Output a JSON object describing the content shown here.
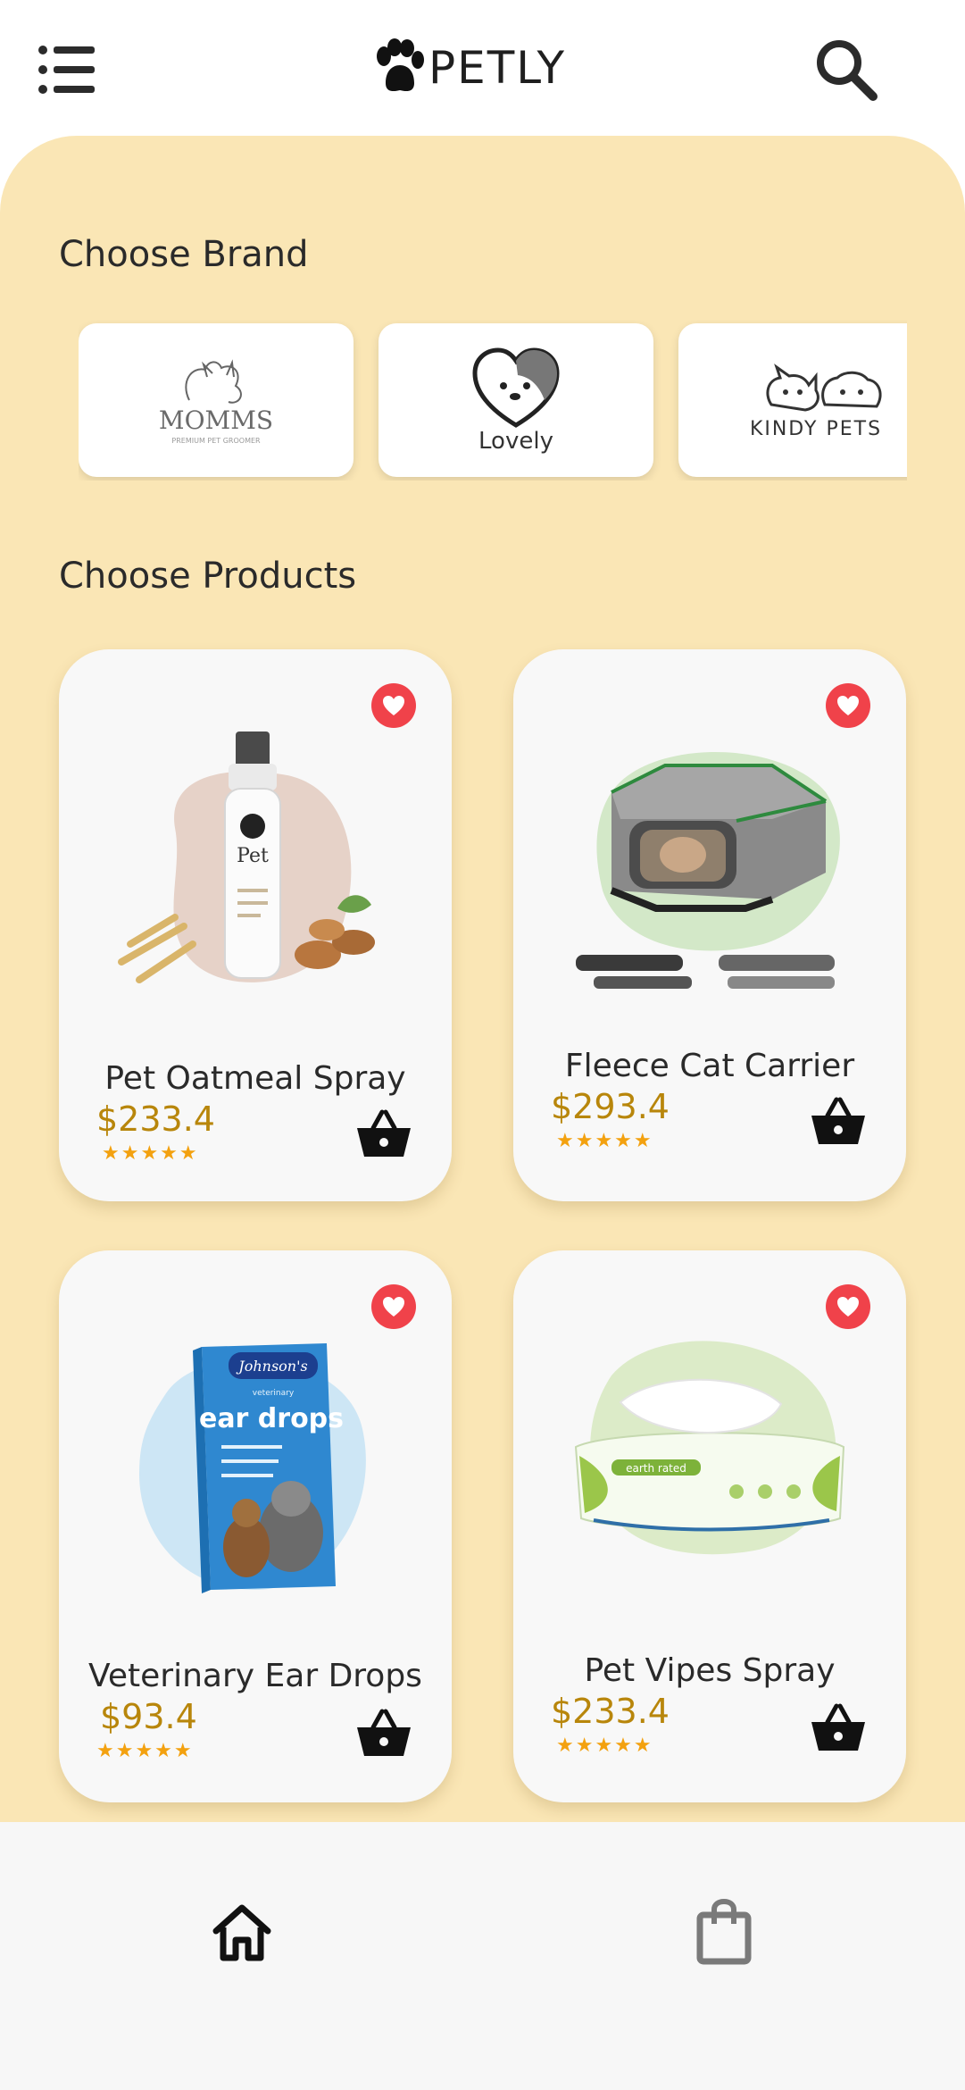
{
  "header": {
    "menu_icon": "list-menu-icon",
    "logo_icon": "paw-icon",
    "brand_name": "PETLY",
    "search_icon": "search-icon"
  },
  "brands_section": {
    "title": "Choose Brand",
    "brands": [
      {
        "name": "MOMMS",
        "tagline": "PREMIUM PET GROOMER"
      },
      {
        "name": "Lovely"
      },
      {
        "name": "KINDY PETS"
      }
    ]
  },
  "products_section": {
    "title": "Choose Products",
    "items": [
      {
        "name": "Pet Oatmeal Spray",
        "price": "$233.4",
        "rating": 5,
        "stars": "★★★★★",
        "favorite": true,
        "image": "spray-bottle",
        "blob_color": "#e6d2c8"
      },
      {
        "name": "Fleece Cat Carrier",
        "price": "$293.4",
        "rating": 5,
        "stars": "★★★★★",
        "favorite": true,
        "image": "pet-carrier",
        "blob_color": "#d3e8c8"
      },
      {
        "name": "Veterinary Ear Drops",
        "price": "$93.4",
        "rating": 5,
        "stars": "★★★★★",
        "favorite": true,
        "image": "ear-drops-box",
        "blob_color": "#cde6f5"
      },
      {
        "name": "Pet Vipes Spray",
        "price": "$233.4",
        "rating": 5,
        "stars": "★★★★★",
        "favorite": true,
        "image": "wipes-pack",
        "blob_color": "#dcebc8"
      }
    ],
    "box_text": {
      "brand": "Johnson's",
      "product": "ear drops",
      "maker_line": "veterinary"
    },
    "spray_label": "Pet",
    "wipes_label": "earth rated"
  },
  "bottom_nav": {
    "items": [
      {
        "icon": "home-icon",
        "active": true
      },
      {
        "icon": "shopping-bag-icon",
        "active": false
      }
    ]
  },
  "colors": {
    "panel_bg": "#fae6b5",
    "price": "#b8860b",
    "stars": "#f3a10f",
    "favorite": "#f0424a"
  }
}
